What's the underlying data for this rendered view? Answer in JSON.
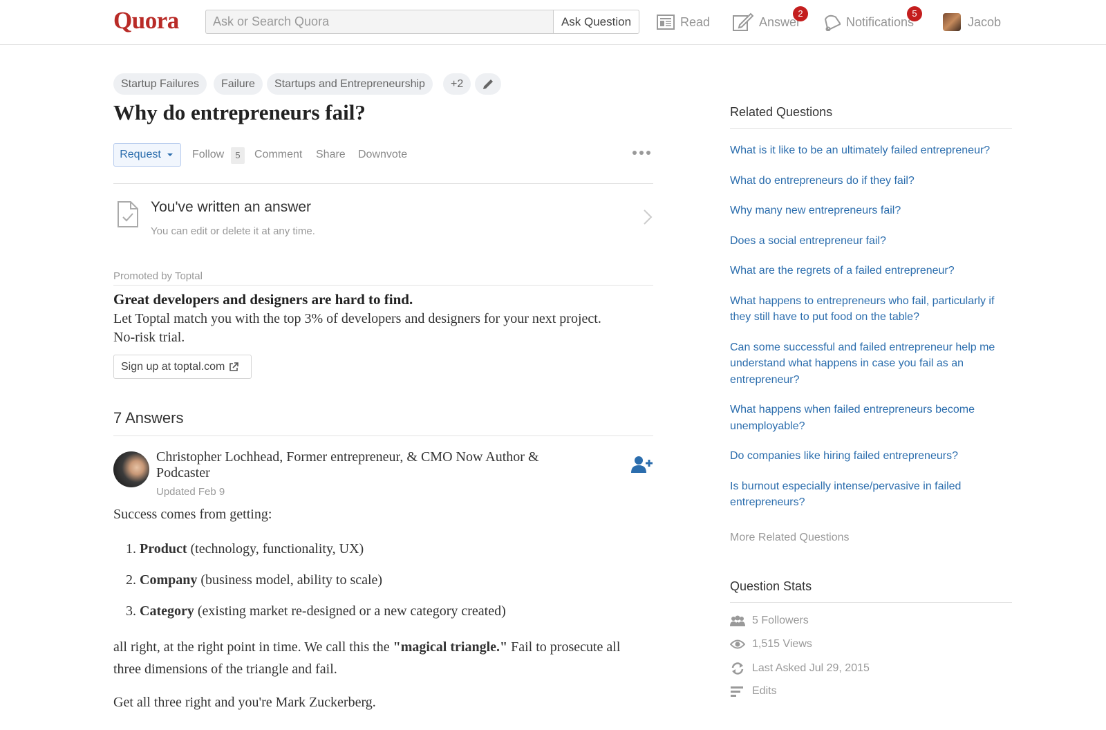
{
  "header": {
    "logo": "Quora",
    "search_placeholder": "Ask or Search Quora",
    "ask_button": "Ask Question",
    "nav": {
      "read": "Read",
      "answer": "Answer",
      "answer_badge": "2",
      "notifications": "Notifications",
      "notifications_badge": "5",
      "user": "Jacob"
    }
  },
  "topics": [
    "Startup Failures",
    "Failure",
    "Startups and Entrepreneurship",
    "+2"
  ],
  "question": {
    "title": "Why do entrepreneurs fail?",
    "actions": {
      "request": "Request",
      "follow": "Follow",
      "follow_count": "5",
      "comment": "Comment",
      "share": "Share",
      "downvote": "Downvote"
    }
  },
  "written_answer": {
    "title": "You've written an answer",
    "subtitle": "You can edit or delete it at any time."
  },
  "promo": {
    "label": "Promoted by Toptal",
    "headline": "Great developers and designers are hard to find.",
    "body": "Let Toptal match you with the top 3% of developers and designers for your next project. No-risk trial.",
    "link": "Sign up at toptal.com"
  },
  "answers": {
    "count_label": "7 Answers",
    "first": {
      "author": "Christopher Lochhead, Former entrepreneur, & CMO Now Author & Podcaster",
      "date": "Updated Feb 9",
      "intro": "Success comes from getting:",
      "list": [
        {
          "num": "1.",
          "bold": "Product",
          "rest": "(technology, functionality, UX)"
        },
        {
          "num": "2.",
          "bold": "Company",
          "rest": "(business model, ability to scale)"
        },
        {
          "num": "3.",
          "bold": "Category",
          "rest": "(existing market re-designed or a new category created)"
        }
      ],
      "p1_before": "all right, at the right point in time. We call this the",
      "p1_bold": "\"magical triangle.\"",
      "p1_after": "Fail to prosecute all three dimensions of the triangle and fail.",
      "p2": "Get all three right and you're Mark Zuckerberg."
    }
  },
  "sidebar": {
    "related_title": "Related Questions",
    "related": [
      "What is it like to be an ultimately failed entrepreneur?",
      "What do entrepreneurs do if they fail?",
      "Why many new entrepreneurs fail?",
      "Does a social entrepreneur fail?",
      "What are the regrets of a failed entrepreneur?",
      "What happens to entrepreneurs who fail, particularly if they still have to put food on the table?",
      "Can some successful and failed entrepreneur help me understand what happens in case you fail as an entrepreneur?",
      "What happens when failed entrepreneurs become unemployable?",
      "Do companies like hiring failed entrepreneurs?",
      "Is burnout especially intense/pervasive in failed entrepreneurs?"
    ],
    "more_related": "More Related Questions",
    "stats_title": "Question Stats",
    "stats": {
      "followers": "5 Followers",
      "views": "1,515 Views",
      "last_asked": "Last Asked Jul 29, 2015",
      "edits": "Edits"
    }
  },
  "colors": {
    "brand": "#b92b27",
    "link": "#2b6dad",
    "badge": "#c41e1e"
  },
  "icons": [
    "read-icon",
    "answer-icon",
    "notifications-icon",
    "pencil-icon",
    "document-check-icon",
    "chevron-right-icon",
    "external-link-icon",
    "follow-user-icon",
    "followers-icon",
    "eye-icon",
    "refresh-icon",
    "edits-icon"
  ]
}
